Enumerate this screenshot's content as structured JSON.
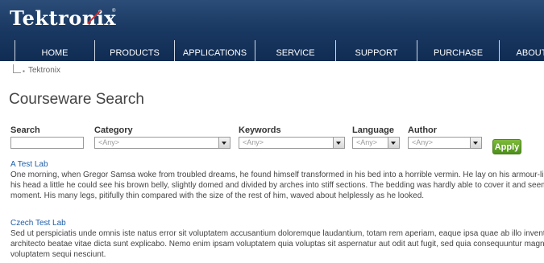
{
  "header": {
    "logo": "Tektronix",
    "logo_reg": "®",
    "nav": [
      "HOME",
      "PRODUCTS",
      "APPLICATIONS",
      "SERVICE",
      "SUPPORT",
      "PURCHASE",
      "ABOUT"
    ]
  },
  "breadcrumb": {
    "bullet": "▪",
    "item": "Tektronix"
  },
  "page": {
    "title": "Courseware Search"
  },
  "form": {
    "search_label": "Search",
    "search_value": "",
    "category_label": "Category",
    "category_value": "<Any>",
    "keywords_label": "Keywords",
    "keywords_value": "<Any>",
    "language_label": "Language",
    "language_value": "<Any>",
    "author_label": "Author",
    "author_value": "<Any>",
    "apply_label": "Apply"
  },
  "results": [
    {
      "title": "A Test Lab",
      "lines": [
        "One morning, when Gregor Samsa woke from troubled dreams, he found himself transformed in his bed into a horrible vermin. He lay on his armour-like back, and if he lifted",
        "his head a little he could see his brown belly, slightly domed and divided by arches into stiff sections. The bedding was hardly able to cover it and seemed ready to slide off any",
        "moment. His many legs, pitifully thin compared with the size of the rest of him, waved about helplessly as he looked."
      ]
    },
    {
      "title": "Czech Test Lab",
      "lines": [
        "Sed ut perspiciatis unde omnis iste natus error sit voluptatem accusantium doloremque laudantium, totam rem aperiam, eaque ipsa quae ab illo inventore veritatis et quasi",
        "architecto beatae vitae dicta sunt explicabo. Nemo enim ipsam voluptatem quia voluptas sit aspernatur aut odit aut fugit, sed quia consequuntur magni dolores eos qui ratione",
        "voluptatem sequi nesciunt."
      ]
    }
  ],
  "colors": {
    "header": "#1a3963",
    "link": "#1f5fa8",
    "apply": "#5a9e24"
  }
}
